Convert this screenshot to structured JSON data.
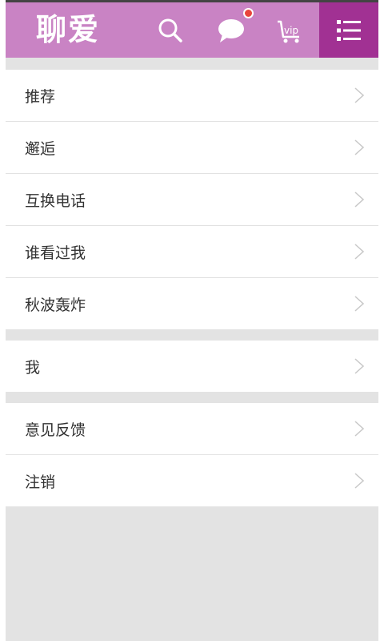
{
  "header": {
    "logo_text": "聊爱",
    "vip_text": "vip",
    "colors": {
      "header_bg": "#c983c4",
      "menu_bg": "#a13193",
      "notify_dot": "#e8453c"
    },
    "icons": [
      "search-icon",
      "chat-bubble-icon",
      "vip-cart-icon",
      "menu-list-icon"
    ]
  },
  "menu_groups": [
    {
      "items": [
        {
          "label": "推荐"
        },
        {
          "label": "邂逅"
        },
        {
          "label": "互换电话"
        },
        {
          "label": "谁看过我"
        },
        {
          "label": "秋波轰炸"
        }
      ]
    },
    {
      "items": [
        {
          "label": "我"
        }
      ]
    },
    {
      "items": [
        {
          "label": "意见反馈"
        },
        {
          "label": "注销"
        }
      ]
    }
  ]
}
